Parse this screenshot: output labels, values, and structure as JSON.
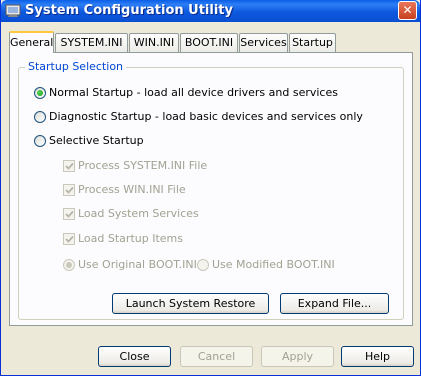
{
  "window": {
    "title": "System Configuration Utility",
    "app_icon": "system-config-icon",
    "close_glyph": "✕"
  },
  "tabs": [
    {
      "label": "General",
      "active": true
    },
    {
      "label": "SYSTEM.INI",
      "active": false
    },
    {
      "label": "WIN.INI",
      "active": false
    },
    {
      "label": "BOOT.INI",
      "active": false
    },
    {
      "label": "Services",
      "active": false
    },
    {
      "label": "Startup",
      "active": false
    }
  ],
  "startup_selection": {
    "group_label": "Startup Selection",
    "normal": {
      "label": "Normal Startup - load all device drivers and services",
      "selected": true
    },
    "diagnostic": {
      "label": "Diagnostic Startup - load basic devices and services only",
      "selected": false
    },
    "selective": {
      "label": "Selective Startup",
      "selected": false,
      "options": [
        {
          "label": "Process SYSTEM.INI File",
          "checked": true,
          "enabled": false
        },
        {
          "label": "Process WIN.INI File",
          "checked": true,
          "enabled": false
        },
        {
          "label": "Load System Services",
          "checked": true,
          "enabled": false
        },
        {
          "label": "Load Startup Items",
          "checked": true,
          "enabled": false
        }
      ],
      "boot_ini": {
        "original": {
          "label": "Use Original BOOT.INI",
          "selected": true,
          "enabled": false
        },
        "modified": {
          "label": "Use Modified BOOT.INI",
          "selected": false,
          "enabled": false
        }
      }
    }
  },
  "panel_buttons": {
    "launch_restore": "Launch System Restore",
    "expand_file": "Expand File..."
  },
  "dialog_buttons": {
    "close": {
      "label": "Close",
      "enabled": true
    },
    "cancel": {
      "label": "Cancel",
      "enabled": false
    },
    "apply": {
      "label": "Apply",
      "enabled": false
    },
    "help": {
      "label": "Help",
      "enabled": true
    }
  },
  "colors": {
    "titlebar": "#0a5fe6",
    "group_label": "#0046d5",
    "radio_selected": "#21a121",
    "disabled_text": "#a1a192",
    "tab_highlight": "#ffc83c"
  }
}
